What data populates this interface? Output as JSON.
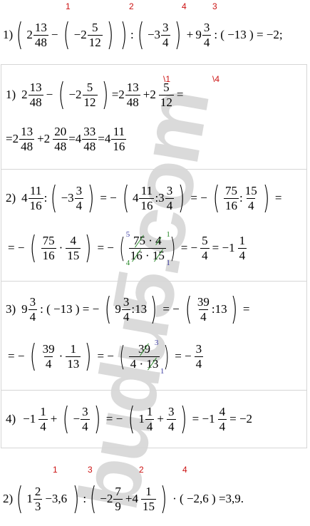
{
  "watermark": "budu5.com",
  "marks": {
    "top": [
      "1",
      "2",
      "4",
      "3"
    ],
    "s1": [
      "\\1",
      "\\4"
    ],
    "bottom": [
      "1",
      "3",
      "2",
      "4"
    ]
  },
  "task1": {
    "label": "1)",
    "expr": "2 13/48 − ( −2 5/12 ) ) : ( −3 3/4 ) + 9 3/4 : ( −13 ) = −2;"
  },
  "step1": {
    "label": "1)",
    "line1": [
      "2",
      "13",
      "48",
      "−",
      "−2",
      "5",
      "12",
      "=2",
      "13",
      "48",
      "+2",
      "5",
      "12",
      "="
    ],
    "line2": [
      "=2",
      "13",
      "48",
      "+2",
      "20",
      "48",
      "=4",
      "33",
      "48",
      "=4",
      "11",
      "16"
    ]
  },
  "step2": {
    "label": "2)",
    "line1": [
      "4",
      "11",
      "16",
      ":",
      "−3",
      "3",
      "4",
      "= −",
      "4",
      "11",
      "16",
      ":3",
      "3",
      "4",
      "= −",
      "75",
      "16",
      ":",
      "15",
      "4",
      "="
    ],
    "line2": [
      "= −",
      "75",
      "16",
      "·",
      "4",
      "15",
      "= −",
      "75 · 4",
      "16 · 15",
      "= −",
      "5",
      "4",
      "= −1",
      "1",
      "4"
    ],
    "notes": [
      "5",
      "1",
      "4",
      "1"
    ]
  },
  "step3": {
    "label": "3)",
    "line1": [
      "9",
      "3",
      "4",
      ": ( −13 ) = −",
      "9",
      "3",
      "4",
      ":13",
      "= −",
      "39",
      "4",
      ":13",
      "="
    ],
    "line2": [
      "= −",
      "39",
      "4",
      "·",
      "1",
      "13",
      "= −",
      "39",
      "4 · 13",
      "= −",
      "3",
      "4"
    ],
    "notes": [
      "3",
      "1"
    ]
  },
  "step4": {
    "label": "4)",
    "line1": [
      "−1",
      "1",
      "4",
      "+",
      "−",
      "3",
      "4",
      "= −",
      "1",
      "1",
      "4",
      "+",
      "3",
      "4",
      "= −1",
      "4",
      "4",
      "= −2"
    ]
  },
  "task2": {
    "label": "2)",
    "expr": [
      "1",
      "2",
      "3",
      "−3,6",
      ":",
      "−2",
      "7",
      "9",
      "+4",
      "1",
      "15",
      "· ( −2,6 ) =3,9."
    ]
  }
}
